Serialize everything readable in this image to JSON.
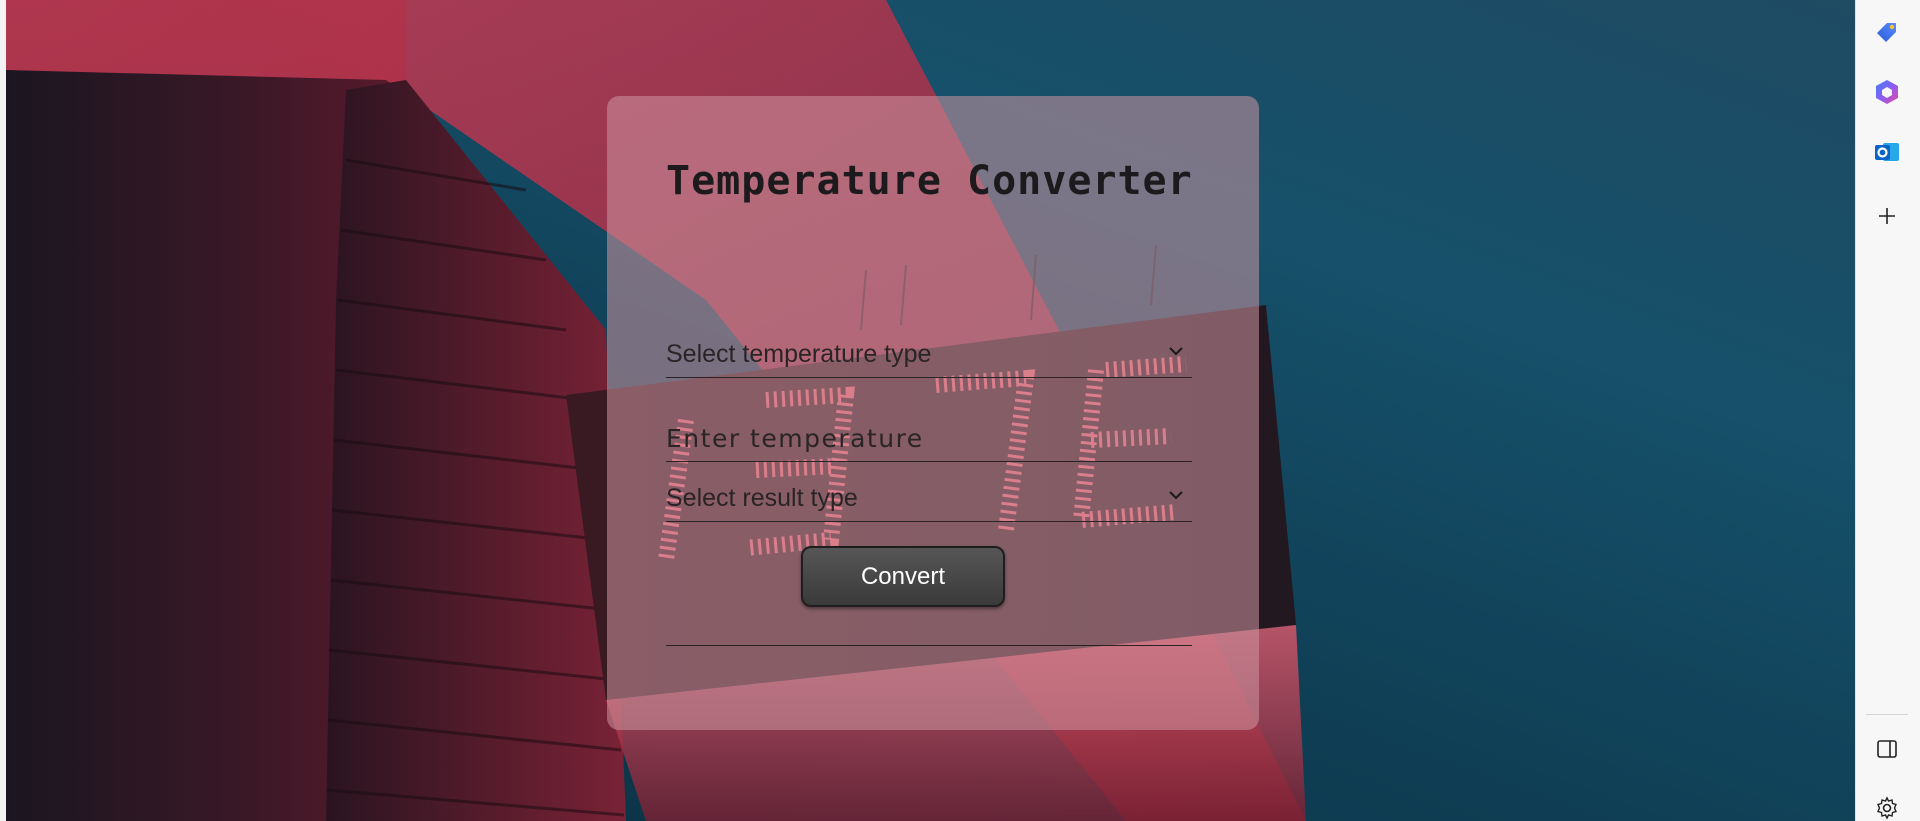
{
  "form": {
    "title": "Temperature Converter",
    "temperature_type_placeholder": "Select temperature type",
    "temperature_input_placeholder": "Enter temperature",
    "result_type_placeholder": "Select result type",
    "convert_label": "Convert",
    "result_text": ""
  },
  "sidebar": {
    "items": [
      {
        "icon": "tag-icon"
      },
      {
        "icon": "copilot-icon"
      },
      {
        "icon": "outlook-icon"
      },
      {
        "icon": "plus-icon"
      }
    ],
    "bottom": [
      {
        "icon": "sidebar-toggle-icon"
      },
      {
        "icon": "settings-gear-icon"
      }
    ]
  },
  "colors": {
    "card_tint": "#cd96a0",
    "button": "#464646",
    "neon_red": "#ff5a6e",
    "sky": "#16506a"
  }
}
